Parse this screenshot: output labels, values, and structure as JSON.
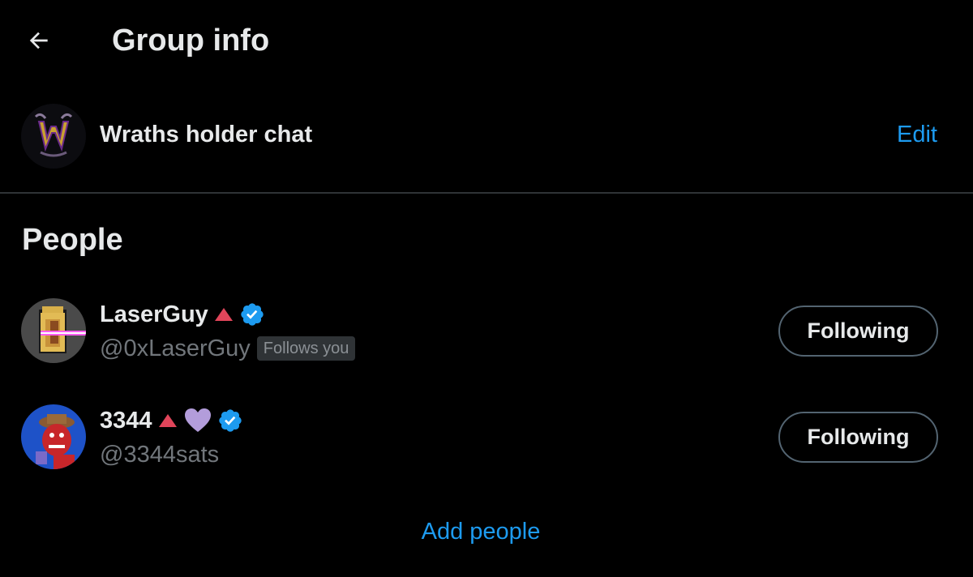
{
  "header": {
    "title": "Group info",
    "back_icon": "arrow-left-icon"
  },
  "group": {
    "name": "Wraths holder chat",
    "edit_label": "Edit",
    "avatar_letter": "W"
  },
  "people_section": {
    "title": "People",
    "members": [
      {
        "name": "LaserGuy",
        "handle": "@0xLaserGuy",
        "follows_you": "Follows you",
        "button_label": "Following",
        "badges": [
          "triangle-icon",
          "verified-icon"
        ]
      },
      {
        "name": "3344",
        "handle": "@3344sats",
        "button_label": "Following",
        "badges": [
          "triangle-icon",
          "purple-heart-icon",
          "verified-icon"
        ]
      }
    ],
    "add_people_label": "Add people"
  },
  "colors": {
    "background": "#000000",
    "text_primary": "#e7e9ea",
    "text_secondary": "#71767b",
    "accent": "#1d9bf0",
    "divider": "#2f3336",
    "triangle": "#f4212e",
    "heart": "#b39ddb"
  }
}
